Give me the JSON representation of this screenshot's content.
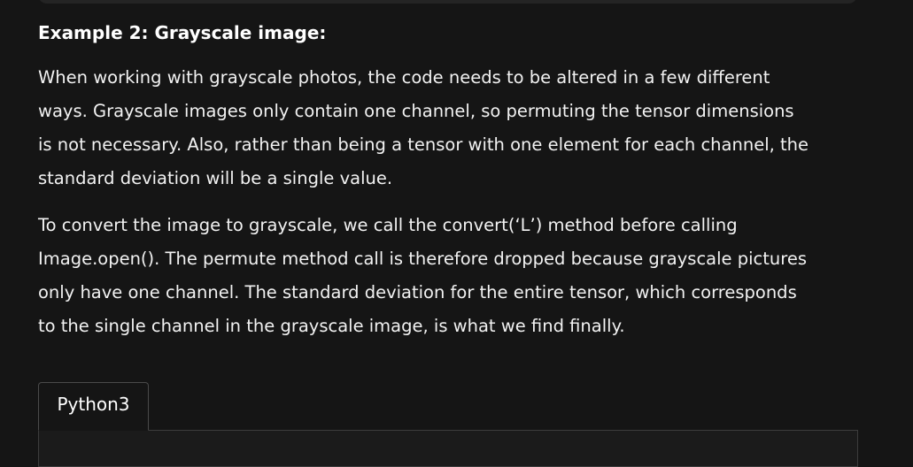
{
  "example": {
    "heading": "Example 2: Grayscale image:",
    "paragraph1_lines": [
      "When working with grayscale photos, the code needs to be altered in a few different",
      "ways. Grayscale images only contain one channel, so permuting the tensor dimensions",
      "is not necessary. Also, rather than being a tensor with one element for each channel, the",
      "standard deviation will be a single value."
    ],
    "paragraph2_lines": [
      "To convert the image to grayscale, we call the convert(‘L’) method before calling",
      "Image.open(). The permute method call is therefore dropped because grayscale pictures",
      "only have one channel. The standard deviation for the entire tensor, which corresponds",
      "to the single channel in the grayscale image, is what we find finally."
    ]
  },
  "code_block": {
    "tab_label": "Python3"
  },
  "colors": {
    "background": "#151515",
    "text": "#ffffff",
    "tab_border": "#4a4a4a"
  }
}
